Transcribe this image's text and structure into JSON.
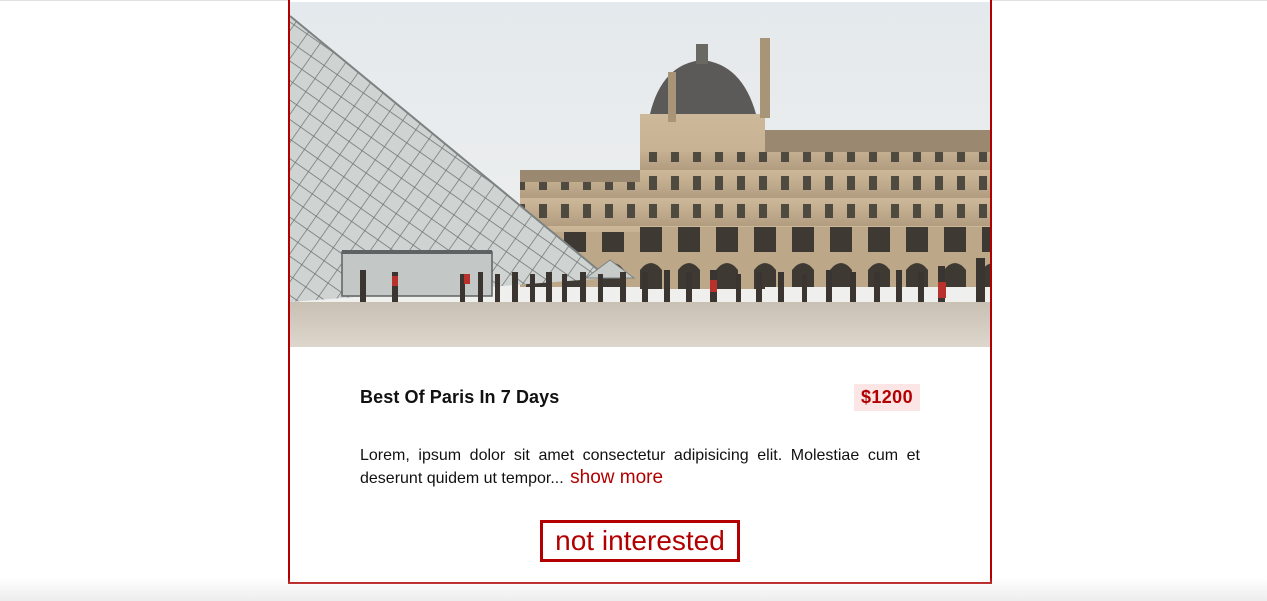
{
  "tour": {
    "image_alt": "Louvre museum glass pyramid and palace courtyard in Paris",
    "title": "Best Of Paris In 7 Days",
    "price": "$1200",
    "info": "Lorem, ipsum dolor sit amet consectetur adipisicing elit. Molestiae cum et deserunt quidem ut tempor...",
    "show_more_label": "show more",
    "not_interested_label": "not interested"
  },
  "colors": {
    "accent": "#b20000",
    "price_background": "#fbe5e5",
    "text": "#111111"
  }
}
